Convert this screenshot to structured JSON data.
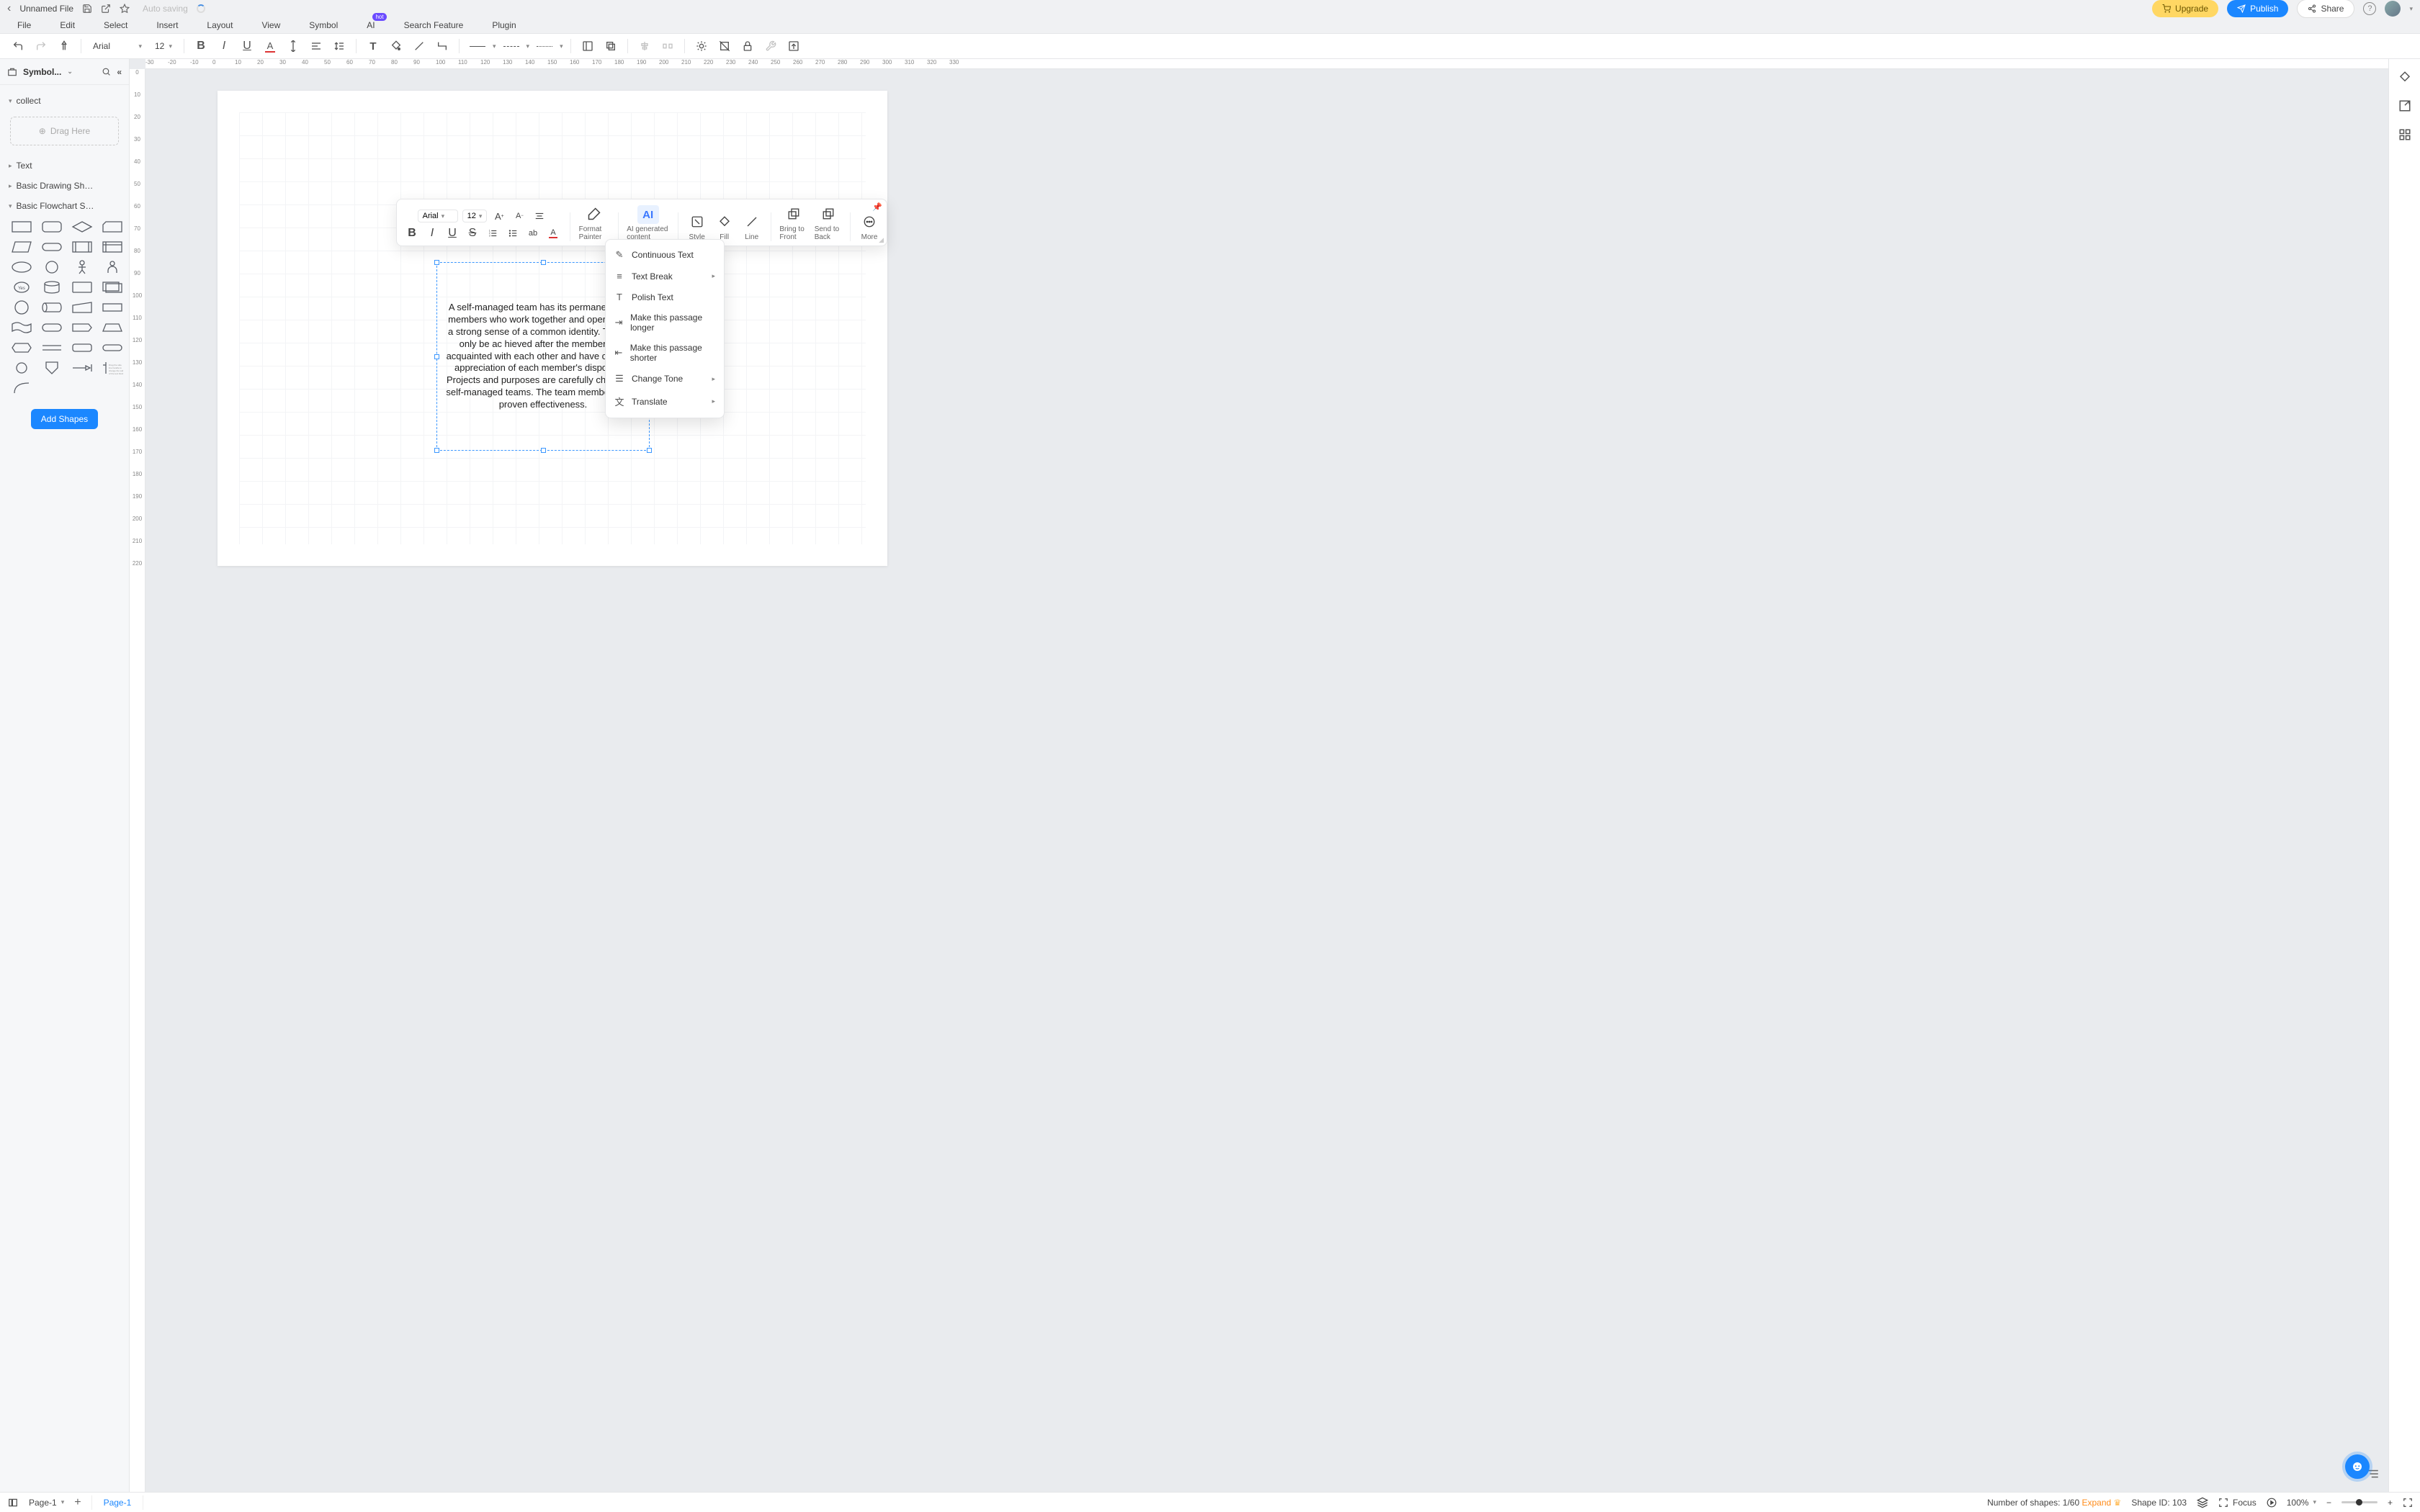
{
  "title": {
    "filename": "Unnamed File",
    "autosave": "Auto saving"
  },
  "menubar": {
    "file": "File",
    "edit": "Edit",
    "select": "Select",
    "insert": "Insert",
    "layout": "Layout",
    "view": "View",
    "symbol": "Symbol",
    "ai": "AI",
    "ai_tag": "hot",
    "search": "Search Feature",
    "plugin": "Plugin"
  },
  "header_buttons": {
    "upgrade": "Upgrade",
    "publish": "Publish",
    "share": "Share"
  },
  "toolbar": {
    "font": "Arial",
    "font_size": "12"
  },
  "sidebar": {
    "title": "Symbol...",
    "collect": "collect",
    "drag_here": "Drag Here",
    "groups": {
      "text": "Text",
      "basic_drawing": "Basic Drawing Sh…",
      "basic_flowchart": "Basic Flowchart S…"
    },
    "add_shapes": "Add Shapes"
  },
  "hruler_ticks": [
    "-30",
    "-20",
    "-10",
    "0",
    "10",
    "20",
    "30",
    "40",
    "50",
    "60",
    "70",
    "80",
    "90",
    "100",
    "110",
    "120",
    "130",
    "140",
    "150",
    "160",
    "170",
    "180",
    "190",
    "200",
    "210",
    "220",
    "230",
    "240",
    "250",
    "260",
    "270",
    "280",
    "290",
    "300",
    "310",
    "320",
    "330"
  ],
  "vruler_ticks": [
    "0",
    "10",
    "20",
    "30",
    "40",
    "50",
    "60",
    "70",
    "80",
    "90",
    "100",
    "110",
    "120",
    "130",
    "140",
    "150",
    "160",
    "170",
    "180",
    "190",
    "200",
    "210",
    "220"
  ],
  "textbox_content": "A self-managed team has its permanent team members who work together and operate with a strong sense of a common identity. This can only be ac hieved after the members are acquainted with each other and have complete appreciation of each member's disposition. Projects and purposes are carefully chosen for self-managed teams. The team members have proven effectiveness.",
  "float_toolbar": {
    "font": "Arial",
    "font_size": "12",
    "format_painter": "Format Painter",
    "ai_label": "AI",
    "ai_content": "AI generated content",
    "style": "Style",
    "fill": "Fill",
    "line": "Line",
    "front": "Bring to Front",
    "back": "Send to Back",
    "more": "More"
  },
  "ai_menu": {
    "continuous": "Continuous Text",
    "break": "Text Break",
    "polish": "Polish Text",
    "longer": "Make this passage longer",
    "shorter": "Make this passage shorter",
    "tone": "Change Tone",
    "translate": "Translate"
  },
  "status": {
    "page_select": "Page-1",
    "page_tab": "Page-1",
    "shapes_label": "Number of shapes: ",
    "shapes_count": "1/60",
    "expand": "Expand",
    "shape_id_label": "Shape ID: ",
    "shape_id": "103",
    "focus": "Focus",
    "zoom": "100%"
  }
}
